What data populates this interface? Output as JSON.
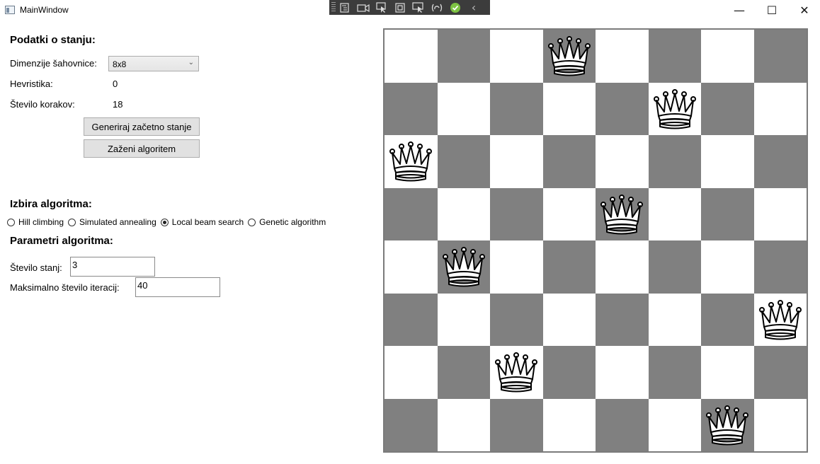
{
  "window": {
    "title": "MainWindow",
    "minimize_glyph": "—",
    "maximize_glyph": "☐",
    "close_glyph": "✕"
  },
  "debug_toolbar": {
    "tools": [
      "live-visual-tree-icon",
      "record-icon",
      "select-element-icon",
      "display-layout-adorners-icon",
      "track-focus-icon",
      "hot-reload-icon",
      "check-icon",
      "collapse-icon"
    ],
    "collapse_glyph": "‹"
  },
  "state": {
    "heading": "Podatki o stanju:",
    "dimensions_label": "Dimenzije šahovnice:",
    "dimensions_value": "8x8",
    "heuristic_label": "Hevristika:",
    "heuristic_value": "0",
    "steps_label": "Število korakov:",
    "steps_value": "18",
    "generate_button": "Generiraj začetno stanje",
    "run_button": "Zaženi algoritem"
  },
  "algorithm": {
    "heading": "Izbira algoritma:",
    "options": [
      "Hill climbing",
      "Simulated annealing",
      "Local beam search",
      "Genetic algorithm"
    ],
    "selected": "Local beam search"
  },
  "params": {
    "heading": "Parametri algoritma:",
    "states_label": "Število stanj:",
    "states_value": "3",
    "iterations_label": "Maksimalno število iteracij:",
    "iterations_value": "40"
  },
  "board": {
    "size": 8,
    "queen_symbol": "white-queen-icon",
    "queen_columns_by_row": [
      3,
      5,
      0,
      4,
      1,
      7,
      2,
      6
    ],
    "dark_color": "#808080",
    "light_color": "#ffffff"
  }
}
